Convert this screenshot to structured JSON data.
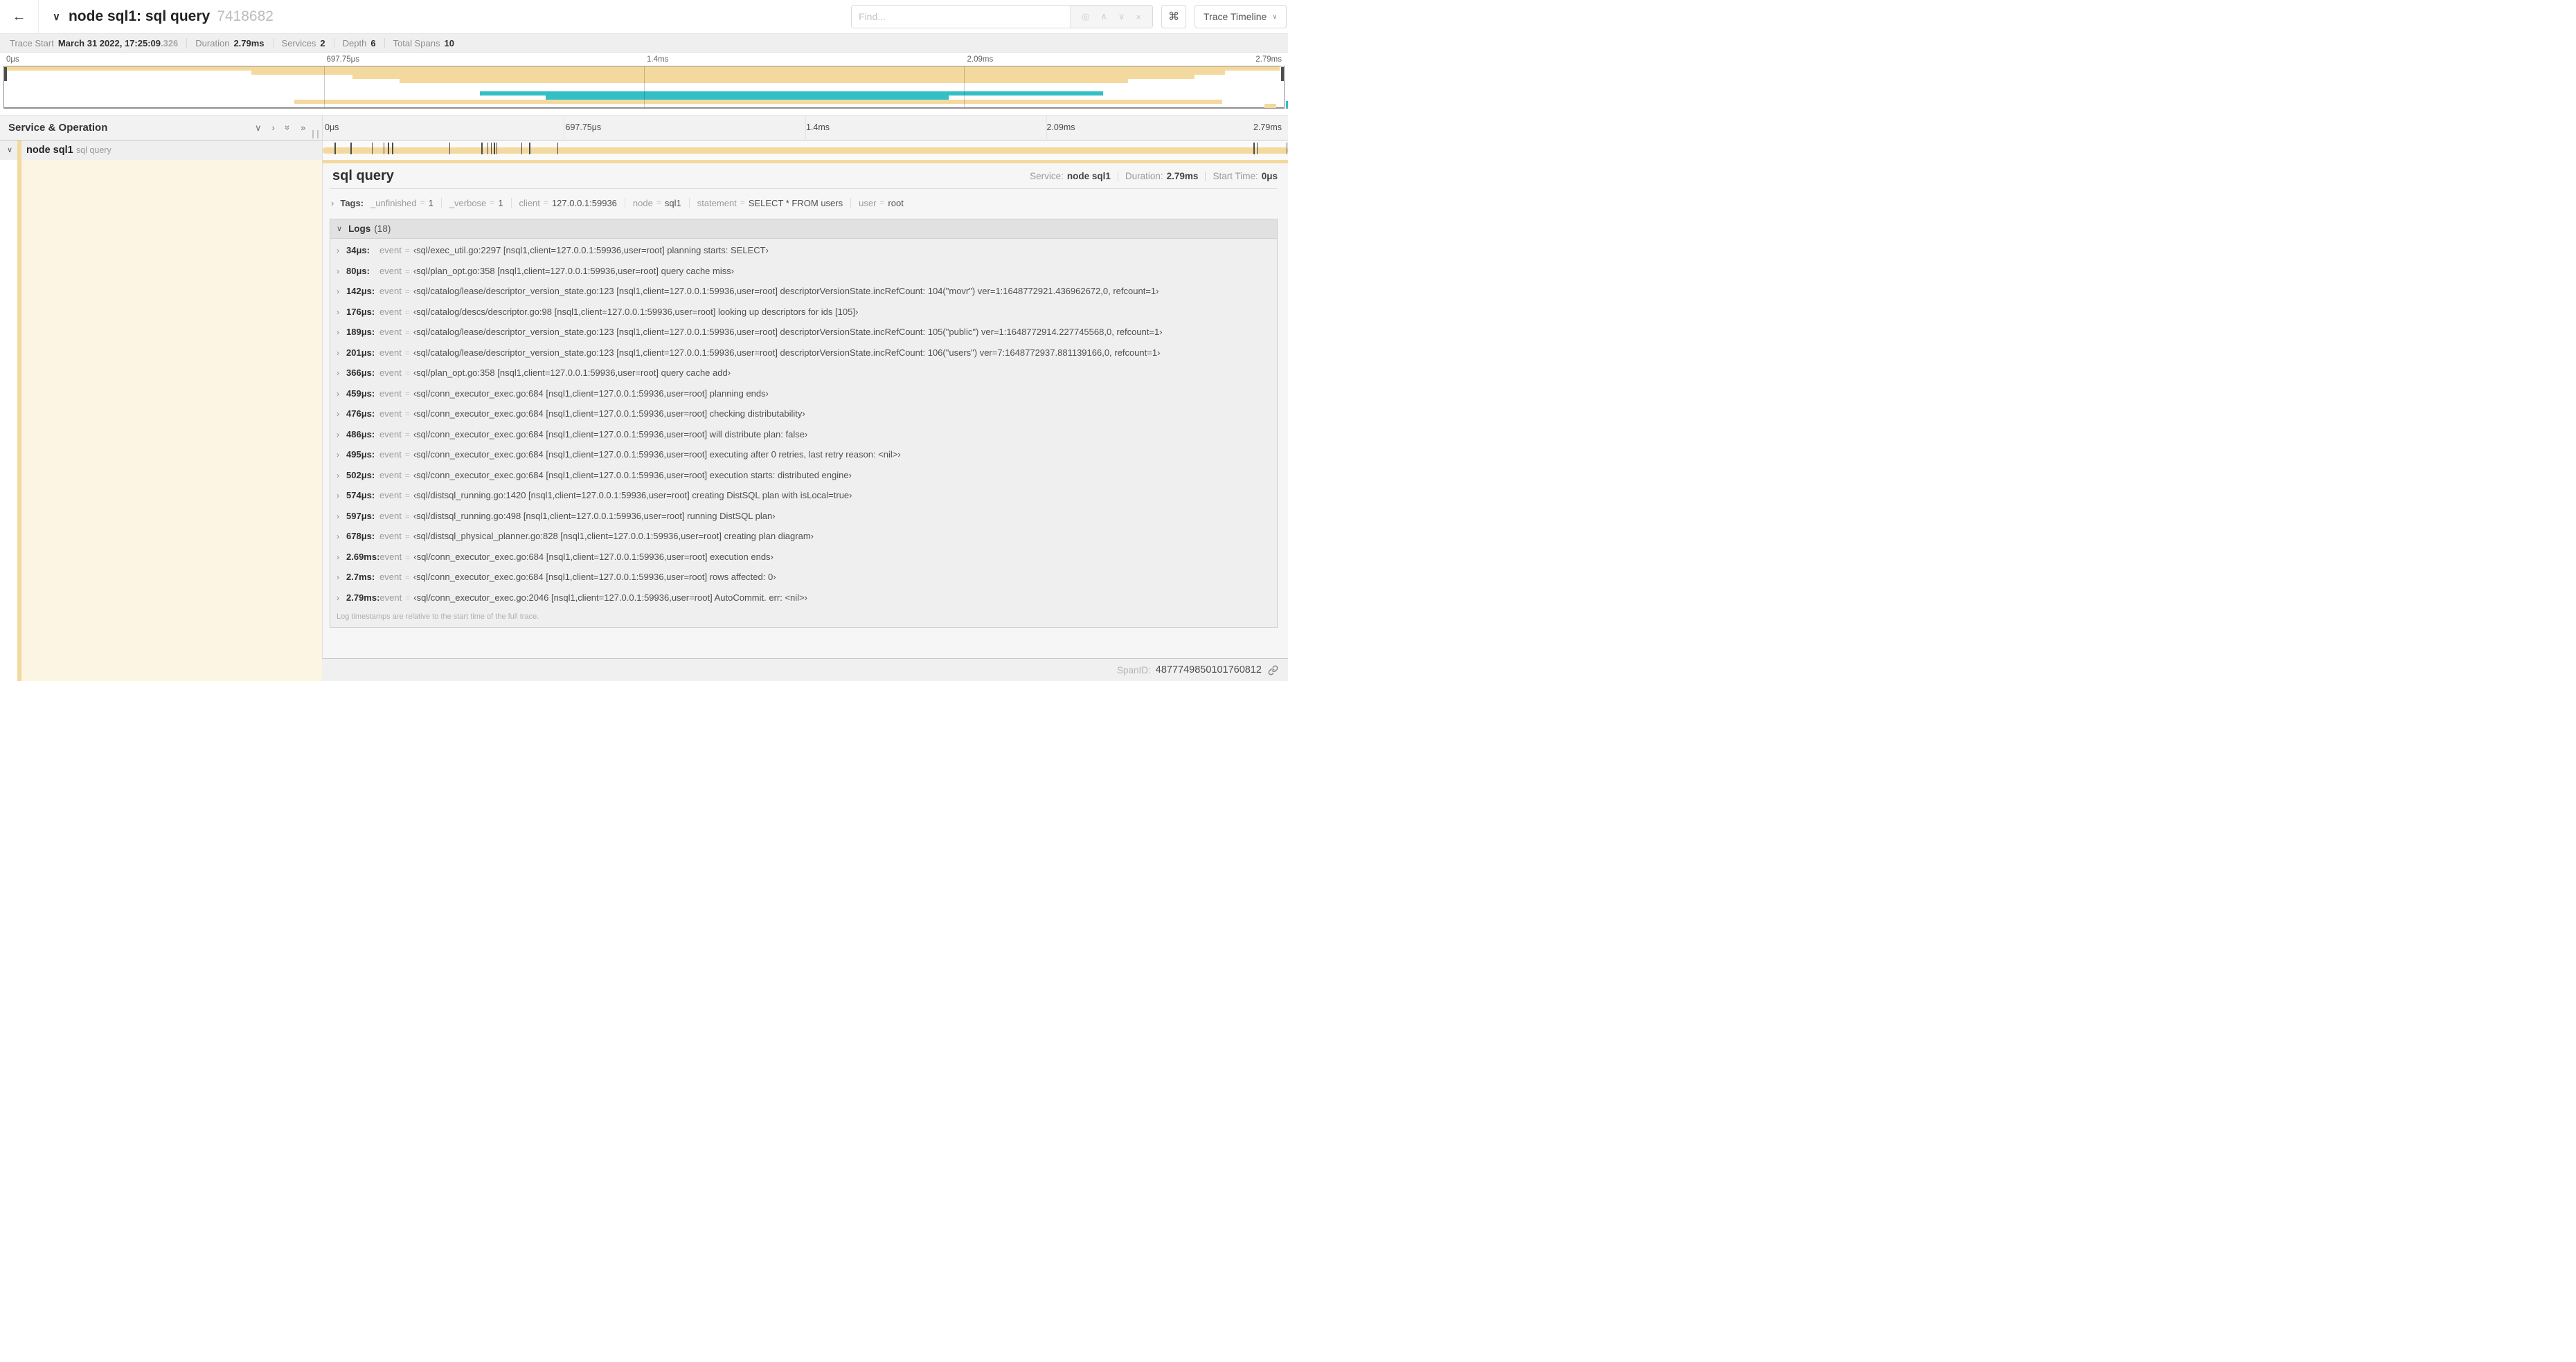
{
  "colors": {
    "tan": "#f4d99e",
    "teal": "#32bfc5",
    "cream": "#fcf5e3"
  },
  "topbar": {
    "back_icon": "←",
    "collapse_icon": "∨",
    "title": "node sql1: sql query",
    "trace_id": "7418682",
    "find_placeholder": "Find...",
    "find_icons": {
      "locate": "◎",
      "prev": "∧",
      "next": "∨",
      "clear": "×"
    },
    "cmd_button": "⌘",
    "view_select": "Trace Timeline",
    "view_select_icon": "∨"
  },
  "summary": {
    "items": [
      {
        "label": "Trace Start",
        "value": "March 31 2022, 17:25:09",
        "suffix": ".326"
      },
      {
        "label": "Duration",
        "value": "2.79ms"
      },
      {
        "label": "Services",
        "value": "2"
      },
      {
        "label": "Depth",
        "value": "6"
      },
      {
        "label": "Total Spans",
        "value": "10"
      }
    ]
  },
  "ruler": {
    "ticks": [
      {
        "label": "0μs",
        "pct": 0
      },
      {
        "label": "697.75μs",
        "pct": 25
      },
      {
        "label": "1.4ms",
        "pct": 50
      },
      {
        "label": "2.09ms",
        "pct": 75
      },
      {
        "label": "2.79ms",
        "pct": 100
      }
    ],
    "gridline_pcts": [
      25,
      50,
      75
    ]
  },
  "minimap": {
    "rows": [
      {
        "color": "tan",
        "start": 0,
        "end": 99.7
      },
      {
        "color": "tan",
        "start": 19.3,
        "end": 95.4
      },
      {
        "color": "tan",
        "start": 27.2,
        "end": 93.0
      },
      {
        "color": "tan",
        "start": 30.9,
        "end": 87.8
      },
      null,
      null,
      {
        "color": "teal",
        "start": 37.2,
        "end": 85.9
      },
      {
        "color": "teal",
        "start": 42.3,
        "end": 73.8
      },
      {
        "color": "tan",
        "start": 22.7,
        "end": 95.2
      },
      {
        "color": "tan",
        "start": 98.5,
        "end": 99.4
      }
    ]
  },
  "timeline": {
    "header": "Service & Operation",
    "header_icons": [
      "∨",
      "›",
      "»",
      "»"
    ],
    "span": {
      "chevron": "∨",
      "service": "node sql1",
      "operation": "sql query",
      "tick_pcts": [
        1.22,
        2.87,
        5.09,
        6.31,
        6.77,
        7.2,
        13.12,
        16.45,
        17.06,
        17.42,
        17.74,
        17.99,
        20.57,
        21.4,
        24.3,
        96.42,
        96.77,
        99.85
      ]
    }
  },
  "detail": {
    "title": "sql query",
    "stats": [
      {
        "label": "Service:",
        "value": "node sql1"
      },
      {
        "label": "Duration:",
        "value": "2.79ms"
      },
      {
        "label": "Start Time:",
        "value": "0μs"
      }
    ],
    "tags": {
      "chevron": "›",
      "label": "Tags:",
      "items": [
        {
          "key": "_unfinished",
          "value": "1"
        },
        {
          "key": "_verbose",
          "value": "1"
        },
        {
          "key": "client",
          "value": "127.0.0.1:59936"
        },
        {
          "key": "node",
          "value": "sql1"
        },
        {
          "key": "statement",
          "value": "SELECT * FROM users"
        },
        {
          "key": "user",
          "value": "root"
        }
      ]
    },
    "logs": {
      "chevron": "∨",
      "label": "Logs",
      "count": "(18)",
      "rows": [
        {
          "time": "34μs:",
          "key": "event",
          "value": "‹sql/exec_util.go:2297 [nsql1,client=127.0.0.1:59936,user=root] planning starts: SELECT›"
        },
        {
          "time": "80μs:",
          "key": "event",
          "value": "‹sql/plan_opt.go:358 [nsql1,client=127.0.0.1:59936,user=root] query cache miss›"
        },
        {
          "time": "142μs:",
          "key": "event",
          "value": "‹sql/catalog/lease/descriptor_version_state.go:123 [nsql1,client=127.0.0.1:59936,user=root] descriptorVersionState.incRefCount: 104(\"movr\") ver=1:1648772921.436962672,0, refcount=1›"
        },
        {
          "time": "176μs:",
          "key": "event",
          "value": "‹sql/catalog/descs/descriptor.go:98 [nsql1,client=127.0.0.1:59936,user=root] looking up descriptors for ids [105]›"
        },
        {
          "time": "189μs:",
          "key": "event",
          "value": "‹sql/catalog/lease/descriptor_version_state.go:123 [nsql1,client=127.0.0.1:59936,user=root] descriptorVersionState.incRefCount: 105(\"public\") ver=1:1648772914.227745568,0, refcount=1›"
        },
        {
          "time": "201μs:",
          "key": "event",
          "value": "‹sql/catalog/lease/descriptor_version_state.go:123 [nsql1,client=127.0.0.1:59936,user=root] descriptorVersionState.incRefCount: 106(\"users\") ver=7:1648772937.881139166,0, refcount=1›"
        },
        {
          "time": "366μs:",
          "key": "event",
          "value": "‹sql/plan_opt.go:358 [nsql1,client=127.0.0.1:59936,user=root] query cache add›"
        },
        {
          "time": "459μs:",
          "key": "event",
          "value": "‹sql/conn_executor_exec.go:684 [nsql1,client=127.0.0.1:59936,user=root] planning ends›"
        },
        {
          "time": "476μs:",
          "key": "event",
          "value": "‹sql/conn_executor_exec.go:684 [nsql1,client=127.0.0.1:59936,user=root] checking distributability›"
        },
        {
          "time": "486μs:",
          "key": "event",
          "value": "‹sql/conn_executor_exec.go:684 [nsql1,client=127.0.0.1:59936,user=root] will distribute plan: false›"
        },
        {
          "time": "495μs:",
          "key": "event",
          "value": "‹sql/conn_executor_exec.go:684 [nsql1,client=127.0.0.1:59936,user=root] executing after 0 retries, last retry reason: <nil>›"
        },
        {
          "time": "502μs:",
          "key": "event",
          "value": "‹sql/conn_executor_exec.go:684 [nsql1,client=127.0.0.1:59936,user=root] execution starts: distributed engine›"
        },
        {
          "time": "574μs:",
          "key": "event",
          "value": "‹sql/distsql_running.go:1420 [nsql1,client=127.0.0.1:59936,user=root] creating DistSQL plan with isLocal=true›"
        },
        {
          "time": "597μs:",
          "key": "event",
          "value": "‹sql/distsql_running.go:498 [nsql1,client=127.0.0.1:59936,user=root] running DistSQL plan›"
        },
        {
          "time": "678μs:",
          "key": "event",
          "value": "‹sql/distsql_physical_planner.go:828 [nsql1,client=127.0.0.1:59936,user=root] creating plan diagram›"
        },
        {
          "time": "2.69ms:",
          "key": "event",
          "value": "‹sql/conn_executor_exec.go:684 [nsql1,client=127.0.0.1:59936,user=root] execution ends›"
        },
        {
          "time": "2.7ms:",
          "key": "event",
          "value": "‹sql/conn_executor_exec.go:684 [nsql1,client=127.0.0.1:59936,user=root] rows affected: 0›"
        },
        {
          "time": "2.79ms:",
          "key": "event",
          "value": "‹sql/conn_executor_exec.go:2046 [nsql1,client=127.0.0.1:59936,user=root] AutoCommit. err: <nil>›"
        }
      ],
      "note": "Log timestamps are relative to the start time of the full trace."
    },
    "footer": {
      "label": "SpanID:",
      "value": "4877749850101760812"
    }
  }
}
